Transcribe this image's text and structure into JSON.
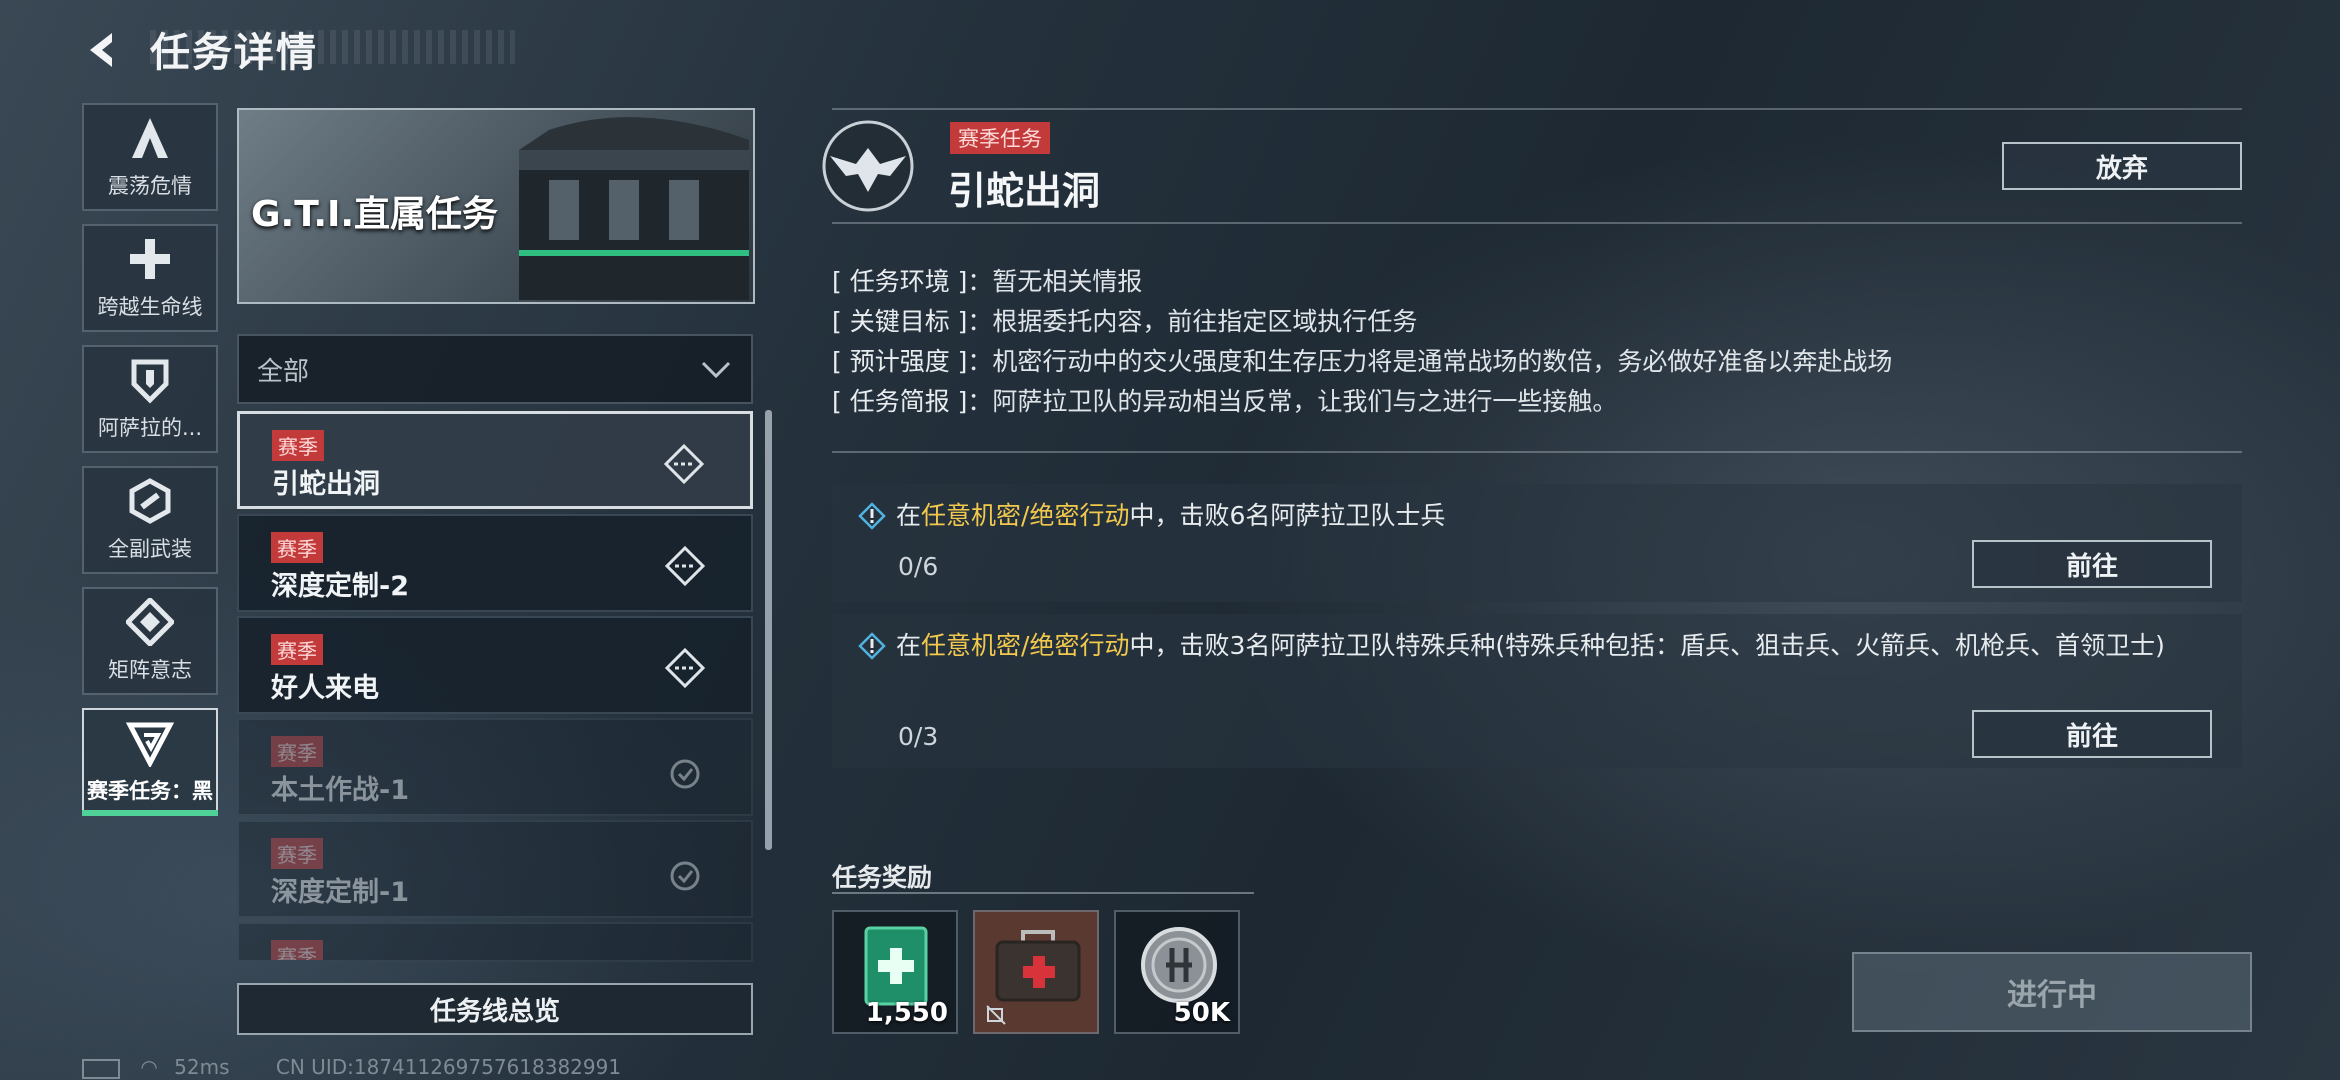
{
  "header": {
    "title": "任务详情"
  },
  "nav": {
    "items": [
      {
        "label": "震荡危情",
        "icon": "a-logo-icon"
      },
      {
        "label": "跨越生命线",
        "icon": "cross-icon"
      },
      {
        "label": "阿萨拉的...",
        "icon": "shield-icon"
      },
      {
        "label": "全副武装",
        "icon": "hexagon-link-icon"
      },
      {
        "label": "矩阵意志",
        "icon": "diamond-matrix-icon"
      },
      {
        "label": "赛季任务：黑",
        "icon": "g-triangle-icon"
      }
    ],
    "active_index": 5
  },
  "banner": {
    "title": "G.T.I.直属任务"
  },
  "filter": {
    "value": "全部"
  },
  "missions": [
    {
      "tag": "赛季",
      "name": "引蛇出洞",
      "state": "selected"
    },
    {
      "tag": "赛季",
      "name": "深度定制-2",
      "state": "available"
    },
    {
      "tag": "赛季",
      "name": "好人来电",
      "state": "available"
    },
    {
      "tag": "赛季",
      "name": "本土作战-1",
      "state": "completed"
    },
    {
      "tag": "赛季",
      "name": "深度定制-1",
      "state": "completed"
    },
    {
      "tag": "赛季",
      "name": "",
      "state": "completed"
    }
  ],
  "overview_button": "任务线总览",
  "status_bar": {
    "ping": "52ms",
    "uid": "CN UID:18741126975761838299​1"
  },
  "detail": {
    "season_tag": "赛季任务",
    "quest_name": "引蛇出洞",
    "abandon_label": "放弃",
    "info": [
      {
        "key": "[ 任务环境 ]",
        "value": "：暂无相关情报"
      },
      {
        "key": "[ 关键目标 ]",
        "value": "：根据委托内容，前往指定区域执行任务"
      },
      {
        "key": "[ 预计强度 ]",
        "value": "：机密行动中的交火强度和生存压力将是通常战场的数倍，务必做好准备以奔赴战场"
      },
      {
        "key": "[ 任务简报 ]",
        "value": "：阿萨拉卫队的异动相当反常，让我们与之进行一些接触。"
      }
    ],
    "objectives": [
      {
        "pre": "在",
        "highlight": "任意机密/绝密行动",
        "post": "中，击败6名阿萨拉卫队士兵",
        "progress": "0/6",
        "go_label": "前往"
      },
      {
        "pre": "在",
        "highlight": "任意机密/绝密行动",
        "post": "中，击败3名阿萨拉卫队特殊兵种(特殊兵种包括：盾兵、狙击兵、火箭兵、机枪兵、首领卫士)",
        "progress": "0/3",
        "go_label": "前往"
      }
    ],
    "reward_title": "任务奖励",
    "rewards": [
      {
        "qty": "1,550",
        "icon": "green-medkit-card-icon"
      },
      {
        "qty": "",
        "icon": "red-medical-case-icon"
      },
      {
        "qty": "50K",
        "icon": "silver-coin-icon"
      }
    ],
    "status_label": "进行中"
  },
  "colors": {
    "accent_green": "#4fd197",
    "season_red": "#c23a3a",
    "highlight_yellow": "#f2c94c"
  }
}
